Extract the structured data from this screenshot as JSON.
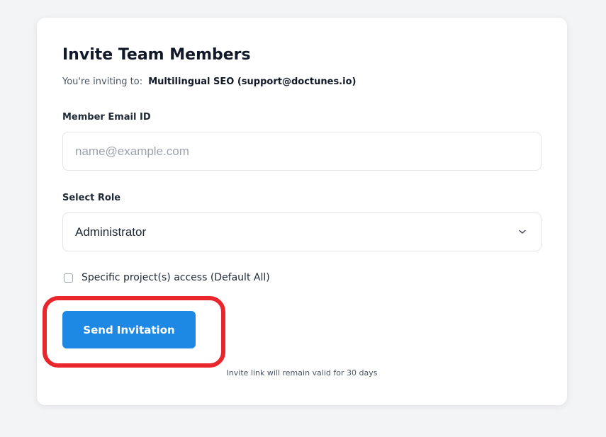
{
  "invite_form": {
    "title": "Invite Team Members",
    "subtitle_prefix": "You're inviting to:",
    "organization": "Multilingual SEO (support@doctunes.io)",
    "email": {
      "label": "Member Email ID",
      "placeholder": "name@example.com",
      "value": ""
    },
    "role": {
      "label": "Select Role",
      "selected": "Administrator",
      "icon": "chevron-down-icon"
    },
    "project_access": {
      "label": "Specific project(s) access (Default All)",
      "checked": false
    },
    "send_button_label": "Send Invitation",
    "note": "Invite link will remain valid for 30 days"
  },
  "colors": {
    "primary_button": "#1e88e5",
    "highlight_outline": "#e8262b",
    "page_background": "#f3f4f6"
  }
}
